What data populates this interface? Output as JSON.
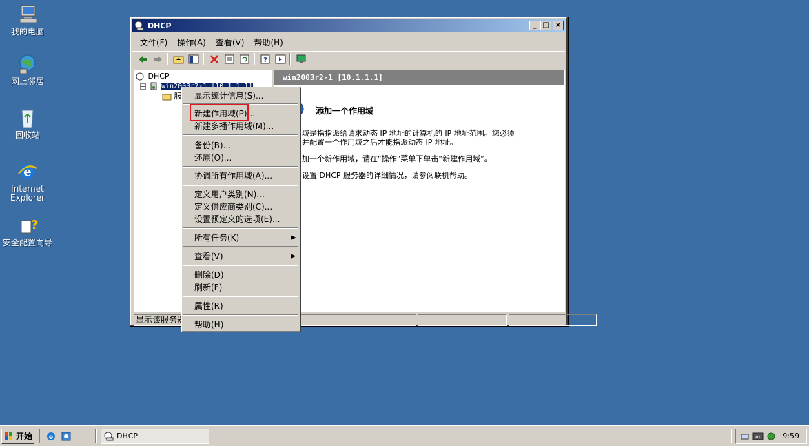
{
  "desktop": {
    "icons": [
      {
        "label": "我的电脑"
      },
      {
        "label": "网上邻居"
      },
      {
        "label": "回收站"
      },
      {
        "label_line1": "Internet",
        "label_line2": "Explorer"
      },
      {
        "label": "安全配置向导"
      }
    ]
  },
  "window": {
    "title": "DHCP",
    "controls": {
      "minimize": "_",
      "maximize": "□",
      "close": "×"
    },
    "menu": [
      "文件(F)",
      "操作(A)",
      "查看(V)",
      "帮助(H)"
    ],
    "tree": {
      "root": "DHCP",
      "server": "win2003r2-1 [10.1.1.1]",
      "child": "服"
    },
    "right_pane": {
      "header": "win2003r2-1 [10.1.1.1]",
      "title": "添加一个作用域",
      "lines": [
        "域是指指派给请求动态 IP 地址的计算机的 IP 地址范围。您必须",
        "并配置一个作用域之后才能指派动态 IP 地址。",
        "加一个新作用域，请在“操作”菜单下单击“新建作用域”。",
        "设置 DHCP 服务器的详细情况，请参阅联机帮助。"
      ]
    },
    "status": "显示该服务器"
  },
  "context_menu": {
    "items": [
      {
        "label": "显示统计信息(S)..."
      },
      {
        "label": "新建作用域(P)..."
      },
      {
        "label": "新建多播作用域(M)..."
      },
      {
        "label": "备份(B)..."
      },
      {
        "label": "还原(O)..."
      },
      {
        "label": "协调所有作用域(A)..."
      },
      {
        "label": "定义用户类别(N)..."
      },
      {
        "label": "定义供应商类别(C)..."
      },
      {
        "label": "设置预定义的选项(E)..."
      },
      {
        "label": "所有任务(K)"
      },
      {
        "label": "查看(V)"
      },
      {
        "label": "删除(D)"
      },
      {
        "label": "刷新(F)"
      },
      {
        "label": "属性(R)"
      },
      {
        "label": "帮助(H)"
      }
    ],
    "highlighted": "新建作用域(P)..."
  },
  "taskbar": {
    "start_label": "开始",
    "task_label": "DHCP",
    "clock": "9:59"
  },
  "colors": {
    "desktop": "#3a6ea5",
    "titlebar_start": "#0a246a",
    "titlebar_end": "#a6caf0",
    "highlight_box": "#e0191e"
  }
}
